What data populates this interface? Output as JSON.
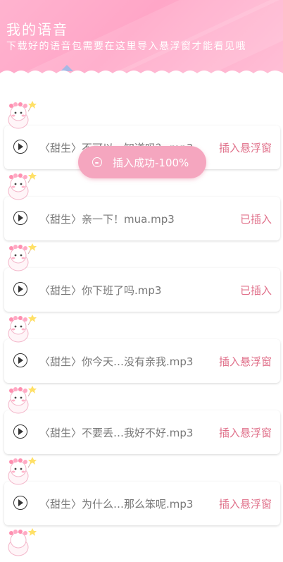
{
  "header": {
    "title": "我的语音",
    "subtitle": "下载好的语音包需要在这里导入悬浮窗才能看见哦",
    "expand_icon": "triangle-up-icon"
  },
  "toast": {
    "icon": "chat-bubble-icon",
    "text": "插入成功-100%"
  },
  "items": [
    {
      "name": "〈甜生〉不可以…知道吗？.mp3",
      "action": "插入悬浮窗",
      "state": "insert"
    },
    {
      "name": "〈甜生〉亲一下！mua.mp3",
      "action": "已插入",
      "state": "inserted"
    },
    {
      "name": "〈甜生〉你下班了吗.mp3",
      "action": "已插入",
      "state": "inserted"
    },
    {
      "name": "〈甜生〉你今天…没有亲我.mp3",
      "action": "插入悬浮窗",
      "state": "insert"
    },
    {
      "name": "〈甜生〉不要丢…我好不好.mp3",
      "action": "插入悬浮窗",
      "state": "insert"
    },
    {
      "name": "〈甜生〉为什么…那么笨呢.mp3",
      "action": "插入悬浮窗",
      "state": "insert"
    }
  ],
  "colors": {
    "banner": "#ffa6c7",
    "action_text": "#e0708a",
    "toast_bg": "#f5a6bf"
  }
}
